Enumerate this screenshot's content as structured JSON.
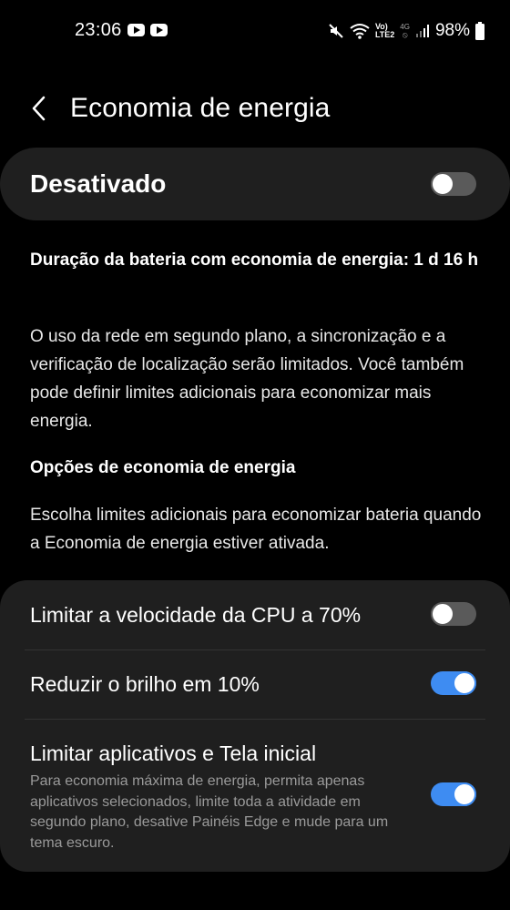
{
  "status_bar": {
    "time": "23:06",
    "battery": "98%",
    "icons": [
      "youtube-icon",
      "youtube-icon",
      "mute-icon",
      "wifi-icon",
      "volte-icon",
      "4g-icon",
      "signal-icon",
      "battery-icon"
    ],
    "volte_text_top": "Vo)",
    "volte_text_bottom": "LTE2",
    "net_text": "4G"
  },
  "header": {
    "title": "Economia de energia"
  },
  "master_toggle": {
    "label": "Desativado",
    "state": "off"
  },
  "info": {
    "duration": "Duração da bateria com economia de energia: 1 d 16 h",
    "description": "O uso da rede em segundo plano, a sincronização e a verificação de localização serão limitados. Você também pode definir limites adicionais para economizar mais energia.",
    "options_title": "Opções de economia de energia",
    "options_description": "Escolha limites adicionais para economizar bateria quando a Economia de energia estiver ativada."
  },
  "options": [
    {
      "label": "Limitar a velocidade da CPU a 70%",
      "state": "off"
    },
    {
      "label": "Reduzir o brilho em 10%",
      "state": "on"
    },
    {
      "label": "Limitar aplicativos e Tela inicial",
      "sublabel": "Para economia máxima de energia, permita apenas aplicativos selecionados, limite toda a atividade em segundo plano, desative Painéis Edge e mude para um tema escuro.",
      "state": "on"
    }
  ],
  "colors": {
    "background": "#000000",
    "card": "#1f1f1f",
    "toggle_on": "#3e8cf2",
    "toggle_off": "#5a5a5a",
    "secondary_text": "#9a9a9a"
  }
}
